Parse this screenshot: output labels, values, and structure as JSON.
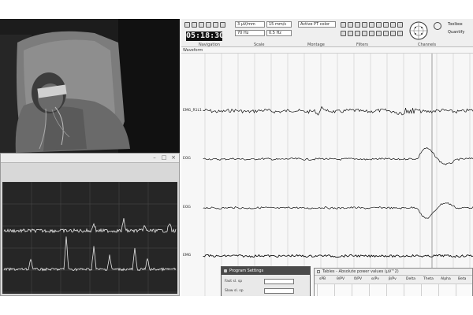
{
  "toolbar": {
    "time": "05:18:30",
    "dropdowns": [
      "3 µV/mm",
      "15 mm/s",
      "70 Hz",
      "0.5 Hz",
      "Active PT color"
    ],
    "groups": [
      "Navigation",
      "Scale",
      "Montage",
      "Filters",
      "Channels"
    ],
    "right_buttons": [
      "Toolbox",
      "Quantify"
    ]
  },
  "waveform": {
    "header": "Waveform",
    "channels": [
      "EMG_R1L1",
      "EOG",
      "EOG",
      "EMG"
    ]
  },
  "program_dialog": {
    "title": "Program Settings",
    "rows": [
      "Fast sl. sp",
      "Slow sl. sp"
    ]
  },
  "table_window": {
    "title": "Tables - Absolute power values (µV^2)",
    "columns": [
      "sPB",
      "θ/PV",
      "δ/PV",
      "α/Pv",
      "β/Pv",
      "Delta",
      "Theta",
      "Alpha",
      "Beta"
    ]
  },
  "spectrum": {
    "window_buttons": [
      "–",
      "□",
      "×"
    ]
  },
  "colors": {
    "video_bg": "#1a1a1a",
    "plot_bg": "#232323",
    "trace": "#111111",
    "accent_dialog": "#4a4a4a"
  }
}
